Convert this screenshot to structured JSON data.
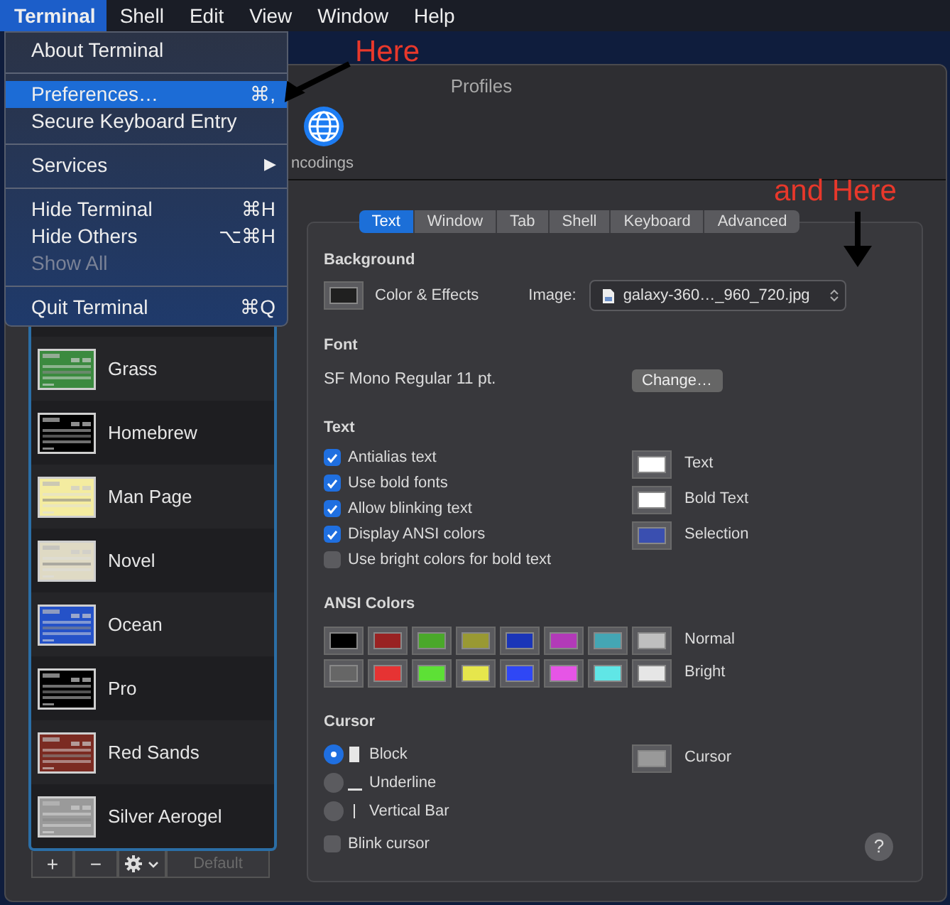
{
  "menu_bar": [
    {
      "label": "Terminal",
      "selected": true
    },
    {
      "label": "Shell",
      "selected": false
    },
    {
      "label": "Edit",
      "selected": false
    },
    {
      "label": "View",
      "selected": false
    },
    {
      "label": "Window",
      "selected": false
    },
    {
      "label": "Help",
      "selected": false
    }
  ],
  "app_menu": [
    {
      "kind": "item",
      "label": "About Terminal",
      "selected": false,
      "disabled": false
    },
    {
      "kind": "separator"
    },
    {
      "kind": "item",
      "label": "Preferences…",
      "shortcut": "⌘,",
      "selected": true,
      "disabled": false
    },
    {
      "kind": "item",
      "label": "Secure Keyboard Entry",
      "selected": false,
      "disabled": false
    },
    {
      "kind": "separator"
    },
    {
      "kind": "item",
      "label": "Services",
      "arrow": "▶",
      "selected": false,
      "disabled": false
    },
    {
      "kind": "separator"
    },
    {
      "kind": "item",
      "label": "Hide Terminal",
      "shortcut": "⌘H",
      "selected": false,
      "disabled": false
    },
    {
      "kind": "item",
      "label": "Hide Others",
      "shortcut": "⌥⌘H",
      "selected": false,
      "disabled": false
    },
    {
      "kind": "item",
      "label": "Show All",
      "selected": false,
      "disabled": true
    },
    {
      "kind": "separator"
    },
    {
      "kind": "item",
      "label": "Quit Terminal",
      "shortcut": "⌘Q",
      "selected": false,
      "disabled": false
    }
  ],
  "annotations": [
    {
      "text": "Here"
    },
    {
      "text": "and Here"
    }
  ],
  "window": {
    "title": "Profiles",
    "toolbar": [
      {
        "label": "ncodings"
      }
    ]
  },
  "profiles": [
    {
      "name": "Grass",
      "color": "#3b8a3f"
    },
    {
      "name": "Homebrew",
      "color": "#000000"
    },
    {
      "name": "Man Page",
      "color": "#f4eca0"
    },
    {
      "name": "Novel",
      "color": "#dfdac4"
    },
    {
      "name": "Ocean",
      "color": "#2552c8"
    },
    {
      "name": "Pro",
      "color": "#000000"
    },
    {
      "name": "Red Sands",
      "color": "#7b2b22"
    },
    {
      "name": "Silver Aerogel",
      "color": "#9a9a9a"
    }
  ],
  "list_buttons": [
    {
      "kind": "add",
      "label": "+",
      "disabled": false
    },
    {
      "kind": "remove",
      "label": "−",
      "disabled": false
    },
    {
      "kind": "gear",
      "disabled": false
    },
    {
      "kind": "text",
      "label": "Default",
      "disabled": true
    }
  ],
  "tabs": [
    {
      "label": "Text",
      "selected": true
    },
    {
      "label": "Window",
      "selected": false
    },
    {
      "label": "Tab",
      "selected": false
    },
    {
      "label": "Shell",
      "selected": false
    },
    {
      "label": "Keyboard",
      "selected": false
    },
    {
      "label": "Advanced",
      "selected": false
    }
  ],
  "background": {
    "heading": "Background",
    "color_effects": "Color & Effects",
    "image_label": "Image:",
    "image_value": "galaxy-360…_960_720.jpg"
  },
  "font": {
    "heading": "Font",
    "value": "SF Mono Regular 11 pt.",
    "button": "Change…"
  },
  "text": {
    "heading": "Text",
    "options": [
      {
        "label": "Antialias text",
        "checked": true
      },
      {
        "label": "Use bold fonts",
        "checked": true
      },
      {
        "label": "Allow blinking text",
        "checked": true
      },
      {
        "label": "Display ANSI colors",
        "checked": true
      },
      {
        "label": "Use bright colors for bold text",
        "checked": false
      }
    ],
    "colors": [
      {
        "label": "Text",
        "color": "#ffffff"
      },
      {
        "label": "Bold Text",
        "color": "#ffffff"
      },
      {
        "label": "Selection",
        "color": "#3a4fb0"
      }
    ]
  },
  "ansi": {
    "heading": "ANSI Colors",
    "rows": [
      {
        "label": "Normal",
        "swatches": [
          {
            "color": "#000000"
          },
          {
            "color": "#992222"
          },
          {
            "color": "#4aa82a"
          },
          {
            "color": "#999933"
          },
          {
            "color": "#1a35b8"
          },
          {
            "color": "#b23ab8"
          },
          {
            "color": "#44a6b4"
          },
          {
            "color": "#bfbfbf"
          }
        ]
      },
      {
        "label": "Bright",
        "swatches": [
          {
            "color": "#666666"
          },
          {
            "color": "#e63333"
          },
          {
            "color": "#5de036"
          },
          {
            "color": "#e6e64c"
          },
          {
            "color": "#2f47f5"
          },
          {
            "color": "#e655e6"
          },
          {
            "color": "#60e6e6"
          },
          {
            "color": "#e6e6e6"
          }
        ]
      }
    ]
  },
  "cursor": {
    "heading": "Cursor",
    "styles": [
      {
        "kind": "block",
        "label": "Block",
        "selected": true
      },
      {
        "kind": "underline",
        "label": "Underline",
        "selected": false
      },
      {
        "kind": "bar",
        "label": "Vertical Bar",
        "selected": false
      }
    ],
    "color_label": "Cursor",
    "color": "#999999",
    "blink": {
      "label": "Blink cursor",
      "checked": false
    }
  },
  "help": "?"
}
